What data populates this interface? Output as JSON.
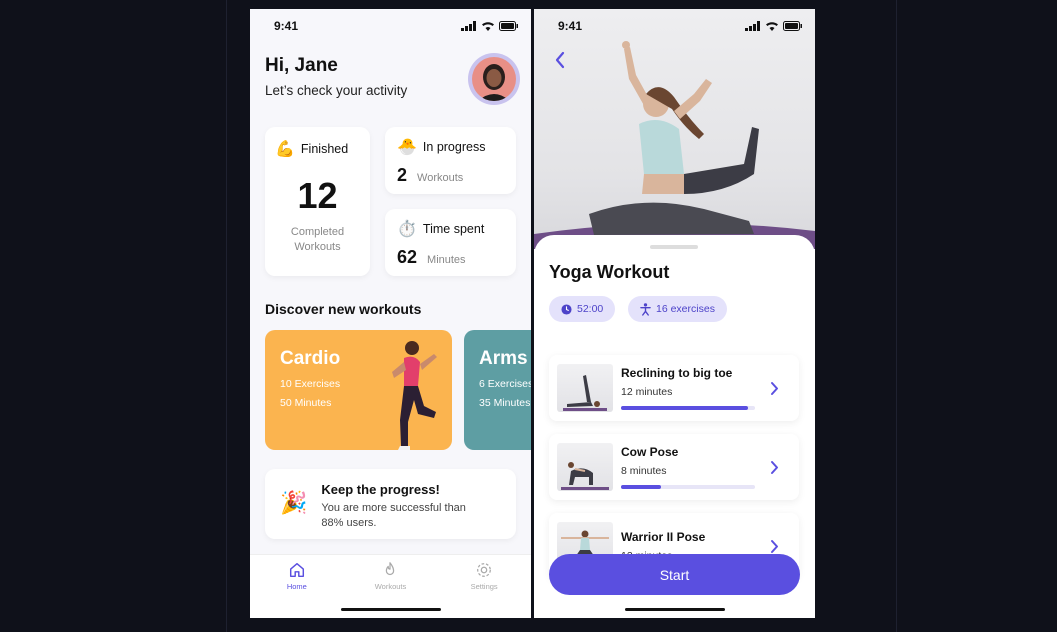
{
  "status_bar": {
    "time": "9:41"
  },
  "home": {
    "greeting": "Hi, Jane",
    "subtitle": "Let’s check your activity",
    "finished": {
      "title": "Finished",
      "emoji": "💪",
      "value": "12",
      "caption_line1": "Completed",
      "caption_line2": "Workouts"
    },
    "in_progress": {
      "title": "In progress",
      "emoji": "🐣",
      "value": "2",
      "unit": "Workouts"
    },
    "time_spent": {
      "title": "Time spent",
      "emoji": "⏱️",
      "value": "62",
      "unit": "Minutes"
    },
    "discover_title": "Discover new workouts",
    "workouts": [
      {
        "name": "Cardio",
        "exercises": "10 Exercises",
        "minutes": "50 Minutes",
        "color": "#fbb44f"
      },
      {
        "name": "Arms",
        "exercises": "6 Exercises",
        "minutes": "35 Minutes",
        "color": "#5e9ea3"
      }
    ],
    "keep": {
      "emoji": "🎉",
      "title": "Keep the progress!",
      "line1": "You are more successful than",
      "line2": "88% users."
    },
    "tabs": [
      {
        "label": "Home",
        "icon": "home-icon",
        "active": true
      },
      {
        "label": "Workouts",
        "icon": "flame-icon",
        "active": false
      },
      {
        "label": "Settings",
        "icon": "gear-icon",
        "active": false
      }
    ]
  },
  "detail": {
    "title": "Yoga Workout",
    "duration": "52:00",
    "exercise_count": "16 exercises",
    "exercises": [
      {
        "name": "Reclining to big toe",
        "duration": "12 minutes",
        "progress": 0.95
      },
      {
        "name": "Cow Pose",
        "duration": "8 minutes",
        "progress": 0.3
      },
      {
        "name": "Warrior II Pose",
        "duration": "12 minutes",
        "progress": 0
      }
    ],
    "start_label": "Start"
  },
  "colors": {
    "accent": "#5a4fe0",
    "chip_bg": "#e4e2fb"
  }
}
